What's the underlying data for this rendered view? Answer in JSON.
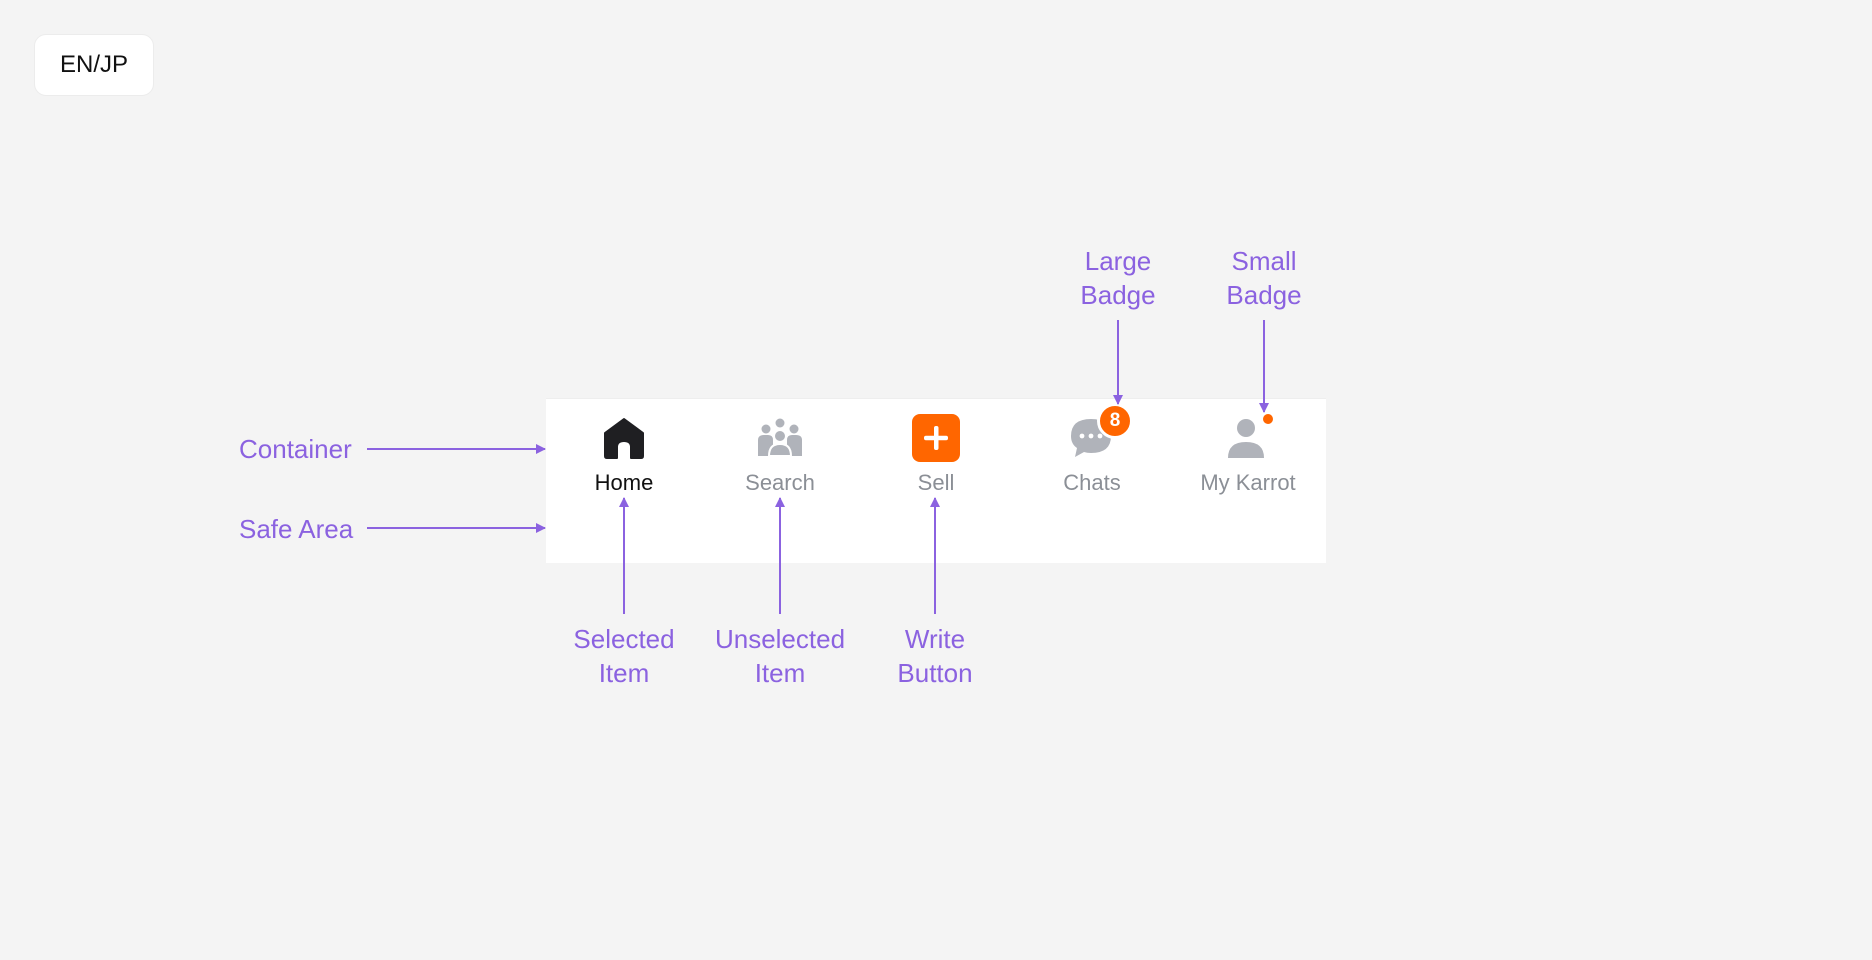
{
  "lang_toggle": "EN/JP",
  "tabbar": {
    "items": [
      {
        "label": "Home",
        "icon": "home-icon",
        "state": "selected"
      },
      {
        "label": "Search",
        "icon": "people-icon",
        "state": "unselected"
      },
      {
        "label": "Sell",
        "icon": "plus-icon",
        "state": "write-button"
      },
      {
        "label": "Chats",
        "icon": "chat-bubble-icon",
        "state": "unselected",
        "badge": "8"
      },
      {
        "label": "My Karrot",
        "icon": "person-icon",
        "state": "unselected",
        "badge": "dot"
      }
    ]
  },
  "annotations": {
    "container": "Container",
    "safe_area": "Safe Area",
    "selected_item": [
      "Selected",
      "Item"
    ],
    "unselected_item": [
      "Unselected",
      "Item"
    ],
    "write_button": [
      "Write",
      "Button"
    ],
    "large_badge": [
      "Large",
      "Badge"
    ],
    "small_badge": [
      "Small",
      "Badge"
    ]
  },
  "colors": {
    "annotation": "#8b62e0",
    "accent": "#ff6600",
    "selected": "#111111",
    "unselected": "#8b8f96",
    "icon_unselected": "#b0b3ba"
  }
}
